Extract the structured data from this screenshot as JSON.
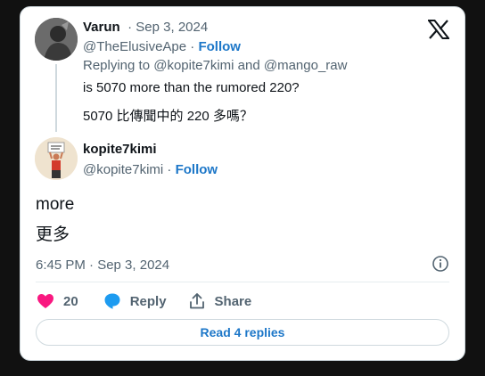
{
  "reply_to_tweet": {
    "name": "Varun",
    "date": "· Sep 3, 2024",
    "handle": "@TheElusiveApe",
    "separator": " · ",
    "follow": "Follow",
    "replying_prefix": "Replying to ",
    "mention1": "@kopite7kimi",
    "and": " and ",
    "mention2": "@mango_raw",
    "text_en": "is 5070 more than the rumored 220?",
    "text_zh": "5070 比傳聞中的 220 多嗎？"
  },
  "tweet": {
    "name": "kopite7kimi",
    "handle": "@kopite7kimi",
    "separator": " · ",
    "follow": "Follow",
    "text_en": "more",
    "text_zh": "更多",
    "timestamp": "6:45 PM · Sep 3, 2024"
  },
  "actions": {
    "like_count": "20",
    "reply_label": "Reply",
    "share_label": "Share"
  },
  "read_replies": "Read 4 replies",
  "colors": {
    "link": "#1d77c8",
    "like": "#f91880",
    "reply_icon": "#1d9bf0"
  },
  "icons": [
    "x-logo-icon",
    "info-icon",
    "heart-icon",
    "reply-bubble-icon",
    "share-icon"
  ]
}
